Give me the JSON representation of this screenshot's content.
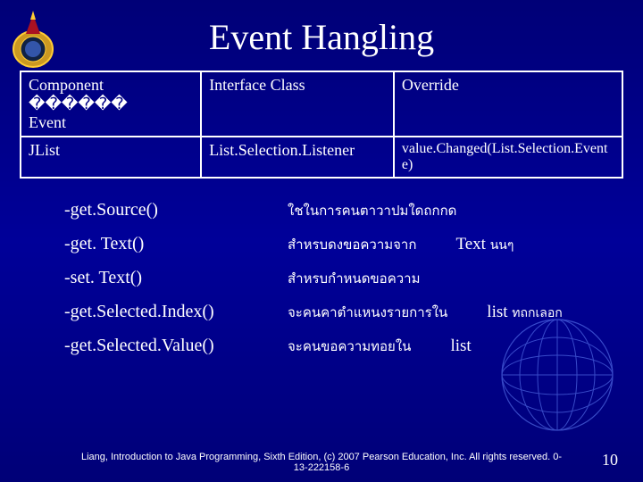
{
  "title": "Event Hangling",
  "table": {
    "header": {
      "col1a": "Component ������",
      "col1b": "Event",
      "col2": "Interface Class",
      "col3": "Override"
    },
    "row": {
      "col1": "JList",
      "col2": "List.Selection.Listener",
      "col3": "value.Changed(List.Selection.Event e)"
    }
  },
  "methods": [
    {
      "name": "-get.Source()",
      "desc": "ใชในการคนตาวาปมใดถกกด",
      "extra": "",
      "extra_sm": ""
    },
    {
      "name": "-get. Text()",
      "desc": "สำหรบดงขอความจาก",
      "extra": "Text",
      "extra_sm": "นนๆ"
    },
    {
      "name": "-set. Text()",
      "desc": "สำหรบกำหนดขอความ",
      "extra": "",
      "extra_sm": ""
    },
    {
      "name": "-get.Selected.Index()",
      "desc": "จะคนคาตำแหนงรายการใน",
      "extra": "list",
      "extra_sm": "ทถกเลอก"
    },
    {
      "name": "-get.Selected.Value()",
      "desc": "จะคนขอความทอยใน",
      "extra": "list",
      "extra_sm": ""
    }
  ],
  "footer": "Liang, Introduction to Java Programming, Sixth Edition, (c) 2007 Pearson Education, Inc. All rights reserved. 0-13-222158-6",
  "page_number": "10"
}
